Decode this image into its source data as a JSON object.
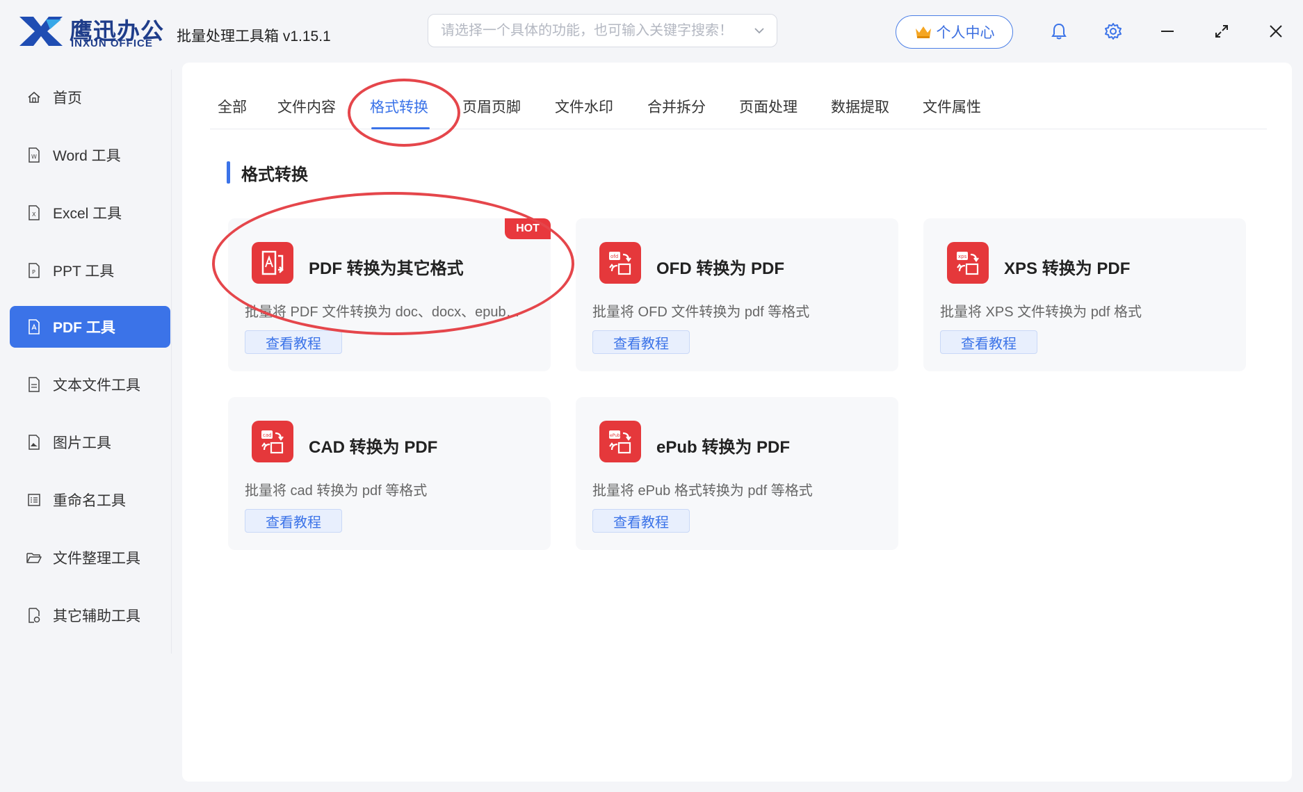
{
  "app": {
    "logo_cn": "鹰迅办公",
    "logo_en": "INXUN OFFICE",
    "title": "批量处理工具箱 v1.15.1"
  },
  "search": {
    "placeholder": "请选择一个具体的功能，也可输入关键字搜索！"
  },
  "header": {
    "user_center": "个人中心"
  },
  "sidebar": {
    "items": [
      {
        "label": "首页",
        "icon": "home-icon"
      },
      {
        "label": "Word 工具",
        "icon": "word-file-icon"
      },
      {
        "label": "Excel 工具",
        "icon": "excel-file-icon"
      },
      {
        "label": "PPT 工具",
        "icon": "ppt-file-icon"
      },
      {
        "label": "PDF 工具",
        "icon": "pdf-file-icon",
        "active": true
      },
      {
        "label": "文本文件工具",
        "icon": "text-file-icon"
      },
      {
        "label": "图片工具",
        "icon": "image-file-icon"
      },
      {
        "label": "重命名工具",
        "icon": "rename-icon"
      },
      {
        "label": "文件整理工具",
        "icon": "folder-icon"
      },
      {
        "label": "其它辅助工具",
        "icon": "tools-icon"
      }
    ]
  },
  "tabs": [
    {
      "label": "全部"
    },
    {
      "label": "文件内容"
    },
    {
      "label": "格式转换",
      "active": true
    },
    {
      "label": "页眉页脚"
    },
    {
      "label": "文件水印"
    },
    {
      "label": "合并拆分"
    },
    {
      "label": "页面处理"
    },
    {
      "label": "数据提取"
    },
    {
      "label": "文件属性"
    }
  ],
  "section": {
    "title": "格式转换"
  },
  "cards": [
    {
      "title": "PDF 转换为其它格式",
      "desc": "批量将 PDF 文件转换为 doc、docx、epub…",
      "button": "查看教程",
      "badge": "HOT",
      "icon": "pdf-convert-icon"
    },
    {
      "title": "OFD 转换为 PDF",
      "desc": "批量将 OFD 文件转换为 pdf 等格式",
      "button": "查看教程",
      "icon": "ofd-convert-icon",
      "icon_tag": "ofd"
    },
    {
      "title": "XPS 转换为 PDF",
      "desc": "批量将 XPS 文件转换为 pdf 格式",
      "button": "查看教程",
      "icon": "xps-convert-icon",
      "icon_tag": "xps"
    },
    {
      "title": "CAD 转换为 PDF",
      "desc": "批量将 cad 转换为 pdf 等格式",
      "button": "查看教程",
      "icon": "cad-convert-icon",
      "icon_tag": "cad"
    },
    {
      "title": "ePub 转换为 PDF",
      "desc": "批量将 ePub 格式转换为 pdf 等格式",
      "button": "查看教程",
      "icon": "epub-convert-icon",
      "icon_tag": "ePub"
    }
  ],
  "colors": {
    "accent": "#3b73e8",
    "brand": "#1f3d8a",
    "card_icon": "#e5383b",
    "annotation": "#e5464b"
  }
}
